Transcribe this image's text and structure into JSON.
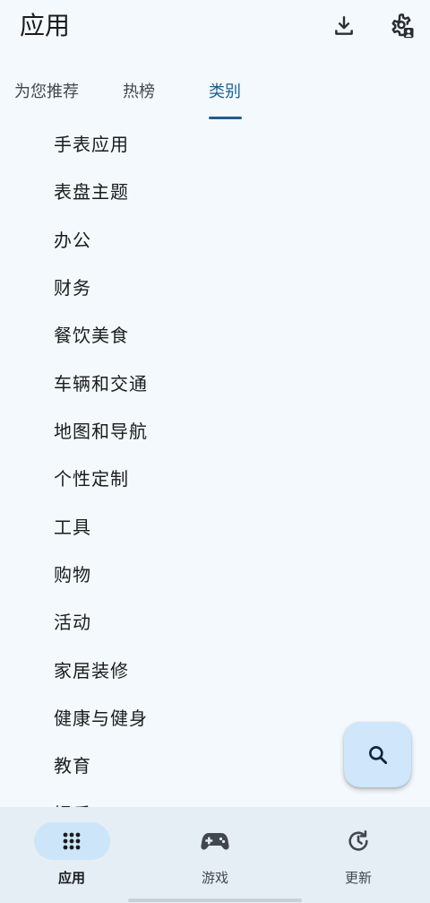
{
  "header": {
    "title": "应用",
    "download_icon": "download-icon",
    "settings_icon": "settings-account-icon"
  },
  "tabs": [
    {
      "label": "为您推荐",
      "selected": false
    },
    {
      "label": "热榜",
      "selected": false
    },
    {
      "label": "类别",
      "selected": true
    }
  ],
  "accent_color": "#1f5f8b",
  "categories": [
    "手表应用",
    "表盘主题",
    "办公",
    "财务",
    "餐饮美食",
    "车辆和交通",
    "地图和导航",
    "个性定制",
    "工具",
    "购物",
    "活动",
    "家居装修",
    "健康与健身",
    "教育",
    "娱乐"
  ],
  "fab": {
    "icon": "search-icon"
  },
  "bottom_nav": [
    {
      "label": "应用",
      "icon": "apps-grid-icon",
      "selected": true
    },
    {
      "label": "游戏",
      "icon": "gamepad-icon",
      "selected": false
    },
    {
      "label": "更新",
      "icon": "update-history-icon",
      "selected": false
    }
  ]
}
